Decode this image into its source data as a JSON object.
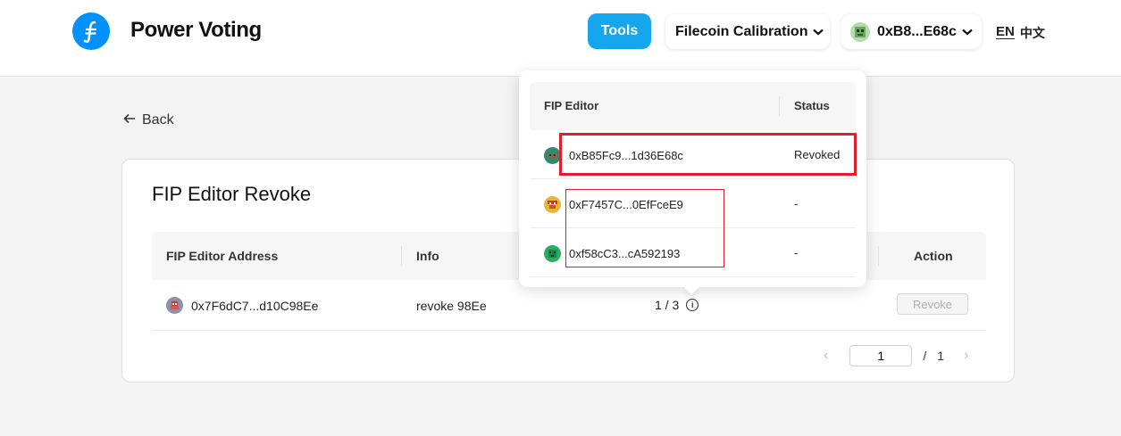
{
  "header": {
    "brand": "Power Voting",
    "tools_label": "Tools",
    "network_label": "Filecoin Calibration",
    "wallet_label": "0xB8...E68c",
    "lang_en": "EN",
    "lang_zh": "中文"
  },
  "back_label": "Back",
  "card": {
    "title": "FIP Editor Revoke",
    "columns": {
      "address": "FIP Editor Address",
      "info": "Info",
      "action": "Action"
    },
    "rows": [
      {
        "address": "0x7F6dC7...d10C98Ee",
        "info": "revoke 98Ee",
        "count": "1 / 3",
        "action_label": "Revoke"
      }
    ],
    "pagination": {
      "current_page": "1",
      "separator": "/",
      "total_pages": "1"
    }
  },
  "popover": {
    "columns": {
      "editor": "FIP Editor",
      "status": "Status"
    },
    "rows": [
      {
        "address": "0xB85Fc9...1d36E68c",
        "status": "Revoked"
      },
      {
        "address": "0xF7457C...0EfFceE9",
        "status": "-"
      },
      {
        "address": "0xf58cC3...cA592193",
        "status": "-"
      }
    ]
  },
  "colors": {
    "accent": "#16a6ee",
    "logo": "#0090ff",
    "highlight": "#e01e2c"
  }
}
